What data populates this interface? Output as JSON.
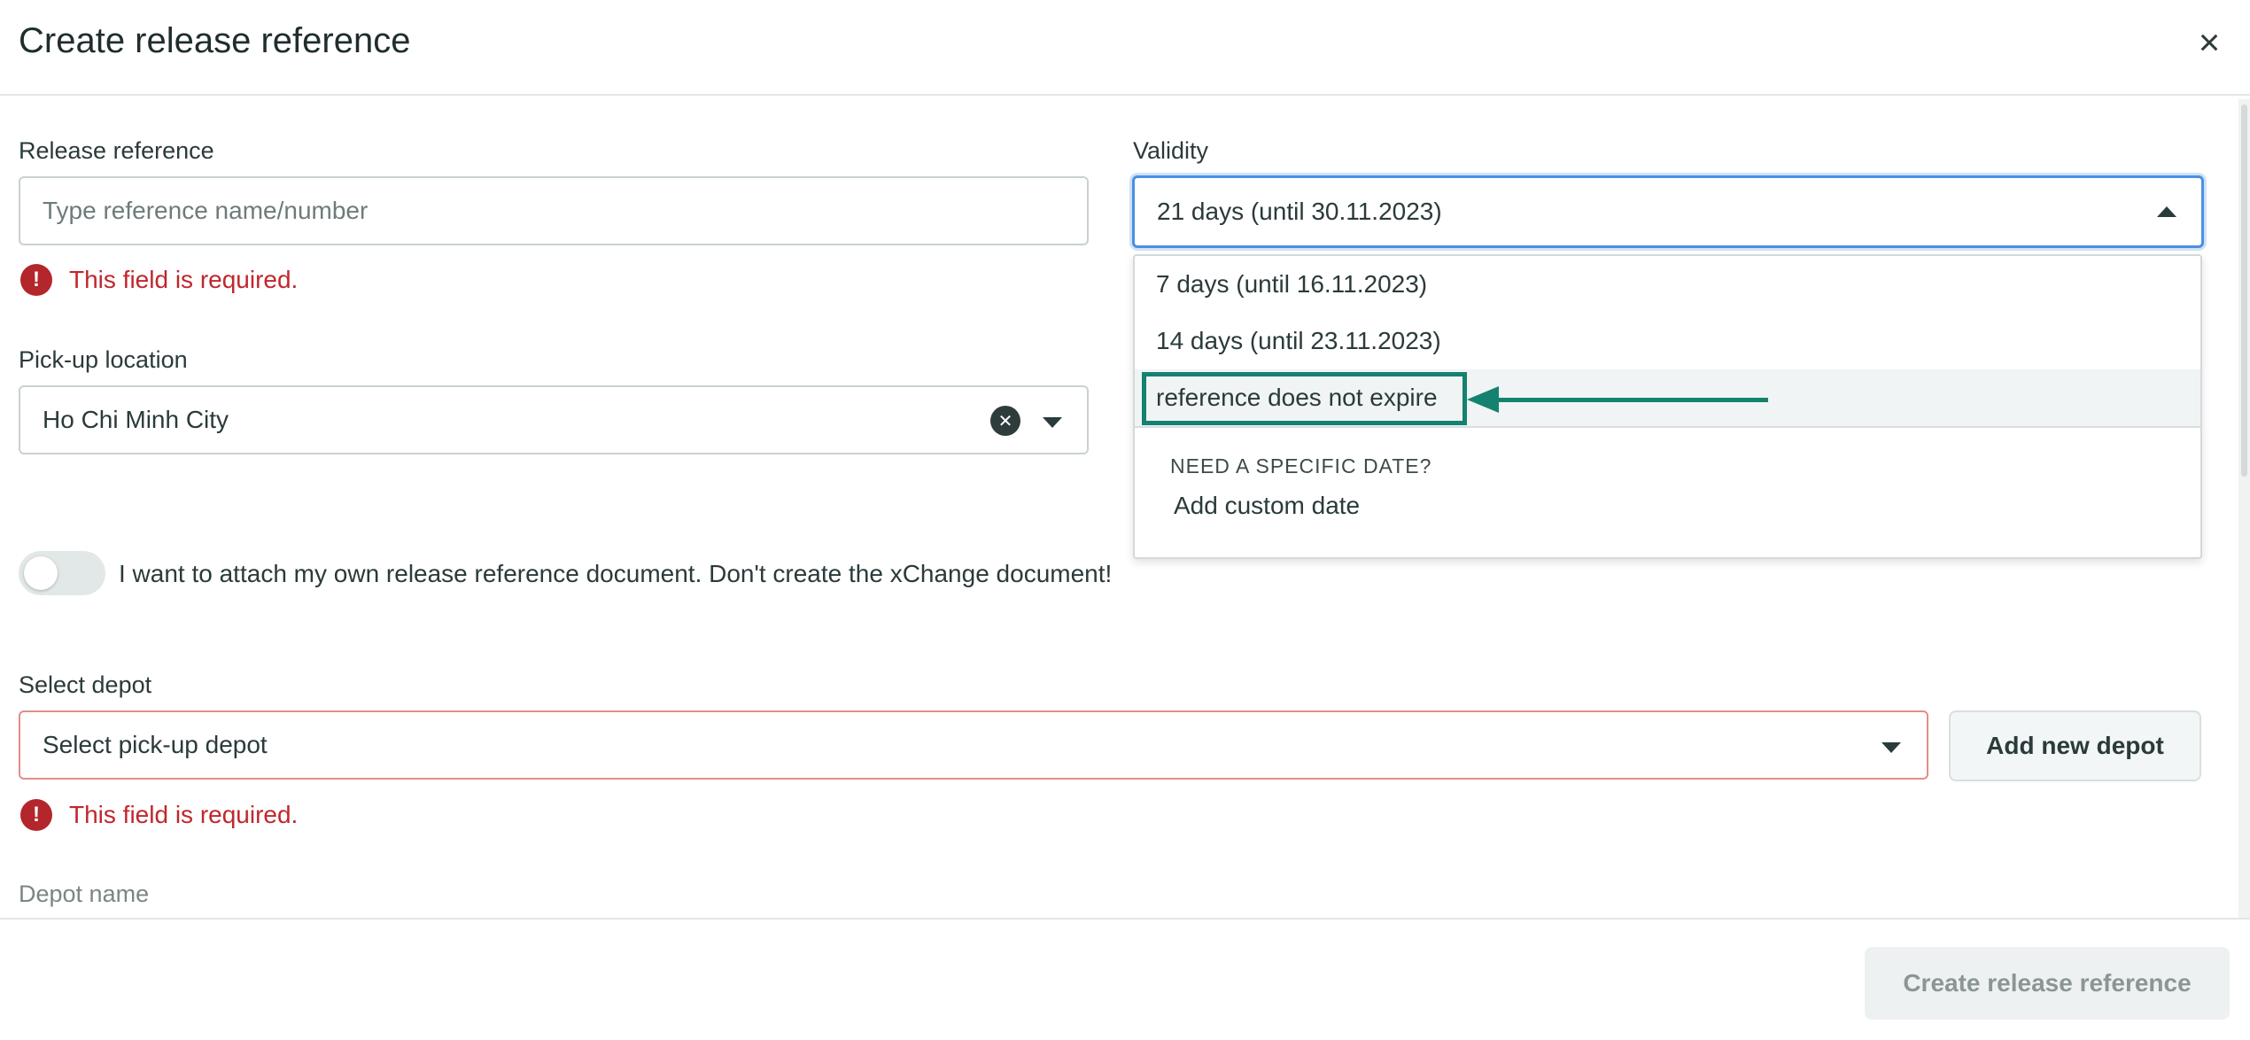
{
  "dialog": {
    "title": "Create release reference",
    "close_icon": "close-icon"
  },
  "release_reference": {
    "label": "Release reference",
    "placeholder": "Type reference name/number",
    "value": "",
    "error": "This field is required."
  },
  "validity": {
    "label": "Validity",
    "selected": "21 days (until 30.11.2023)",
    "options": [
      "7 days (until 16.11.2023)",
      "14 days (until 23.11.2023)",
      "reference does not expire"
    ],
    "section_heading": "NEED A SPECIFIC DATE?",
    "custom_date_label": "Add custom date"
  },
  "pickup_location": {
    "label": "Pick-up location",
    "value": "Ho Chi Minh City"
  },
  "attach_toggle": {
    "checked": false,
    "label": "I want to attach my own release reference document. Don't create the xChange document!"
  },
  "depot": {
    "label": "Select depot",
    "placeholder": "Select pick-up depot",
    "error": "This field is required.",
    "add_button": "Add new depot",
    "name_label": "Depot name"
  },
  "footer": {
    "submit_button": "Create release reference"
  },
  "colors": {
    "error": "#c0272d",
    "focus": "#4a90e2",
    "annotation": "#13826f",
    "text": "#2b3a3a"
  }
}
